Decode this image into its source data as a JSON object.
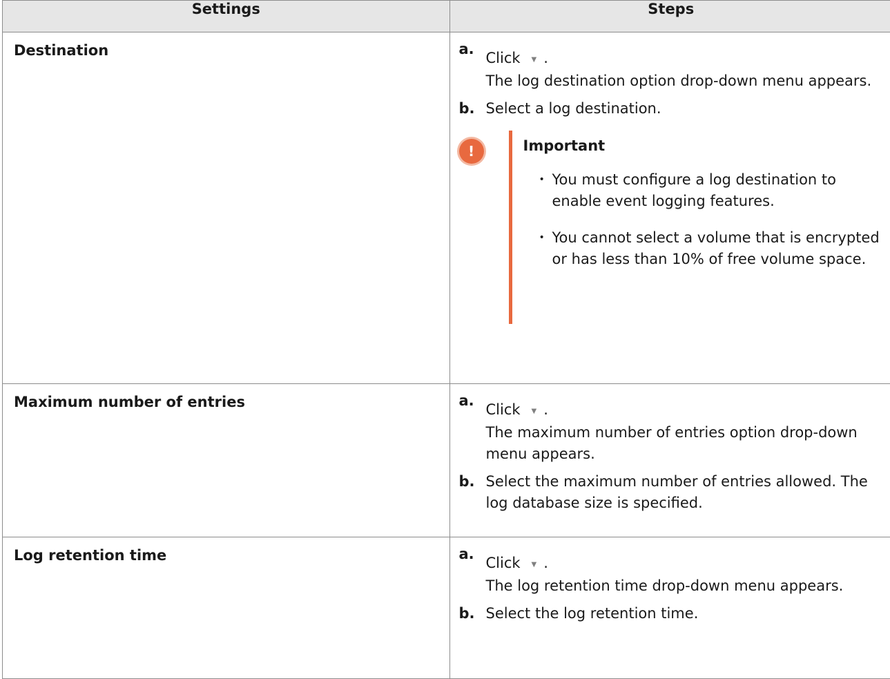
{
  "table": {
    "headers": [
      "Settings",
      "Steps"
    ],
    "rows": [
      {
        "setting": "Destination",
        "step_a_marker": "a.",
        "step_a_click": "Click",
        "step_a_period": ".",
        "step_a_text": "The log destination option drop-down menu appears.",
        "step_b_marker": "b.",
        "step_b_text": "Select a log destination.",
        "important": {
          "icon": "!",
          "title": "Important",
          "items": [
            "You must configure a log destination to enable event logging features.",
            "You cannot select a volume that is encrypted or has less than 10% of free volume space."
          ]
        }
      },
      {
        "setting": "Maximum number of entries",
        "step_a_marker": "a.",
        "step_a_click": "Click",
        "step_a_period": ".",
        "step_a_text": "The maximum number of entries option drop-down menu appears.",
        "step_b_marker": "b.",
        "step_b_text": "Select the maximum number of entries allowed. The log database size is specified."
      },
      {
        "setting": "Log retention time",
        "step_a_marker": "a.",
        "step_a_click": "Click",
        "step_a_period": ".",
        "step_a_text": "The log retention time drop-down menu appears.",
        "step_b_marker": "b.",
        "step_b_text": "Select the log retention time."
      }
    ]
  },
  "icons": {
    "dropdown": "caret-down-icon",
    "important": "exclamation-circle-icon"
  },
  "colors": {
    "accent": "#e8693f",
    "header_bg": "#e6e6e6"
  }
}
